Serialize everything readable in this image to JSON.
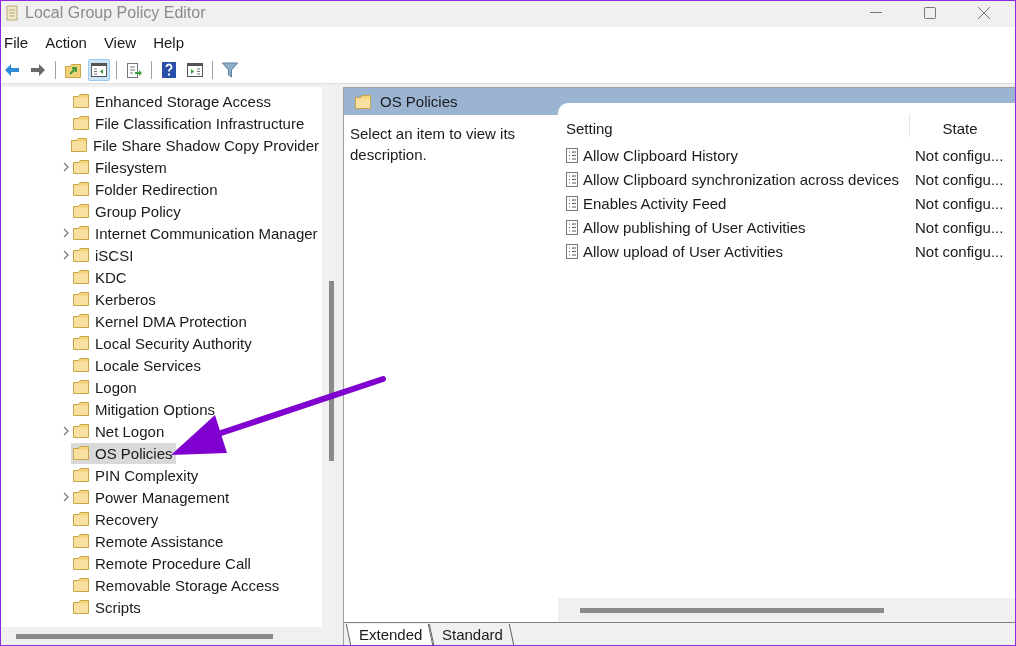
{
  "window": {
    "title": "Local Group Policy Editor"
  },
  "menu": [
    "File",
    "Action",
    "View",
    "Help"
  ],
  "toolbar": [
    {
      "kind": "back",
      "pressed": false
    },
    {
      "kind": "forward",
      "pressed": false
    },
    {
      "kind": "sep"
    },
    {
      "kind": "up",
      "pressed": false
    },
    {
      "kind": "tree",
      "pressed": true
    },
    {
      "kind": "sep"
    },
    {
      "kind": "export",
      "pressed": false
    },
    {
      "kind": "sep"
    },
    {
      "kind": "help",
      "pressed": false
    },
    {
      "kind": "pane",
      "pressed": false
    },
    {
      "kind": "sep"
    },
    {
      "kind": "filter",
      "pressed": false
    }
  ],
  "tree": {
    "items": [
      {
        "label": "Enhanced Storage Access",
        "expandable": false,
        "selected": false
      },
      {
        "label": "File Classification Infrastructure",
        "expandable": false,
        "selected": false
      },
      {
        "label": "File Share Shadow Copy Provider",
        "expandable": false,
        "selected": false
      },
      {
        "label": "Filesystem",
        "expandable": true,
        "selected": false
      },
      {
        "label": "Folder Redirection",
        "expandable": false,
        "selected": false
      },
      {
        "label": "Group Policy",
        "expandable": false,
        "selected": false
      },
      {
        "label": "Internet Communication Manager",
        "expandable": true,
        "selected": false
      },
      {
        "label": "iSCSI",
        "expandable": true,
        "selected": false
      },
      {
        "label": "KDC",
        "expandable": false,
        "selected": false
      },
      {
        "label": "Kerberos",
        "expandable": false,
        "selected": false
      },
      {
        "label": "Kernel DMA Protection",
        "expandable": false,
        "selected": false
      },
      {
        "label": "Local Security Authority",
        "expandable": false,
        "selected": false
      },
      {
        "label": "Locale Services",
        "expandable": false,
        "selected": false
      },
      {
        "label": "Logon",
        "expandable": false,
        "selected": false
      },
      {
        "label": "Mitigation Options",
        "expandable": false,
        "selected": false
      },
      {
        "label": "Net Logon",
        "expandable": true,
        "selected": false
      },
      {
        "label": "OS Policies",
        "expandable": false,
        "selected": true
      },
      {
        "label": "PIN Complexity",
        "expandable": false,
        "selected": false
      },
      {
        "label": "Power Management",
        "expandable": true,
        "selected": false
      },
      {
        "label": "Recovery",
        "expandable": false,
        "selected": false
      },
      {
        "label": "Remote Assistance",
        "expandable": false,
        "selected": false
      },
      {
        "label": "Remote Procedure Call",
        "expandable": false,
        "selected": false
      },
      {
        "label": "Removable Storage Access",
        "expandable": false,
        "selected": false
      },
      {
        "label": "Scripts",
        "expandable": false,
        "selected": false
      }
    ]
  },
  "details": {
    "header": "OS Policies",
    "description": "Select an item to view its description.",
    "columns": [
      "Setting",
      "State"
    ],
    "rows": [
      {
        "setting": "Allow Clipboard History",
        "state": "Not configu..."
      },
      {
        "setting": "Allow Clipboard synchronization across devices",
        "state": "Not configu..."
      },
      {
        "setting": "Enables Activity Feed",
        "state": "Not configu..."
      },
      {
        "setting": "Allow publishing of User Activities",
        "state": "Not configu..."
      },
      {
        "setting": "Allow upload of User Activities",
        "state": "Not configu..."
      }
    ],
    "tabs": [
      {
        "label": "Extended",
        "selected": true
      },
      {
        "label": "Standard",
        "selected": false
      }
    ]
  }
}
